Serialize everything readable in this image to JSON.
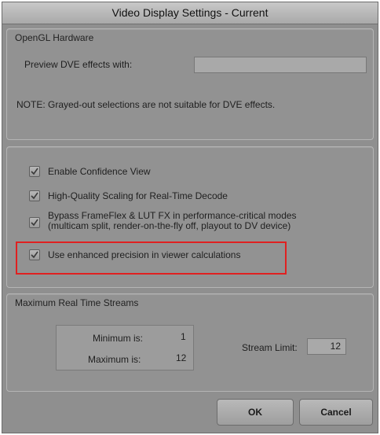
{
  "window": {
    "title": "Video Display Settings - Current"
  },
  "opengl": {
    "group_title": "OpenGL Hardware",
    "preview_label": "Preview DVE effects with:",
    "preview_value": "",
    "note": "NOTE:  Grayed-out selections are not suitable for DVE effects."
  },
  "options": {
    "items": [
      {
        "label": "Enable Confidence View",
        "checked": true
      },
      {
        "label": "High-Quality Scaling for Real-Time Decode",
        "checked": true
      },
      {
        "label": "Bypass FrameFlex & LUT FX in performance-critical modes",
        "label2": "(multicam split, render-on-the-fly off, playout to DV device)",
        "checked": true
      },
      {
        "label": "Use enhanced precision in viewer calculations",
        "checked": true
      }
    ]
  },
  "streams": {
    "group_title": "Maximum Real Time Streams",
    "minimum_label": "Minimum is:",
    "minimum_value": "1",
    "maximum_label": "Maximum is:",
    "maximum_value": "12",
    "stream_limit_label": "Stream Limit:",
    "stream_limit_value": "12"
  },
  "buttons": {
    "ok_label": "OK",
    "cancel_label": "Cancel"
  },
  "colors": {
    "highlight": "#e02020",
    "dialog_bg": "#8f8f8f"
  }
}
